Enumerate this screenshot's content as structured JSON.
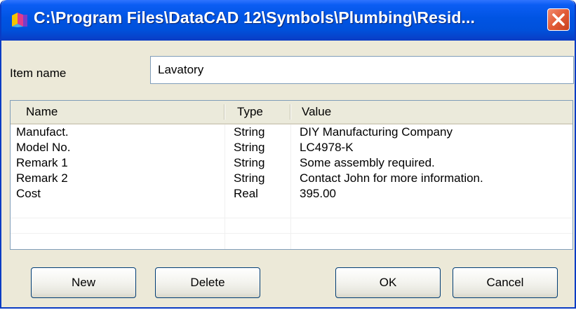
{
  "window": {
    "title": "C:\\Program Files\\DataCAD 12\\Symbols\\Plumbing\\Resid..."
  },
  "item_name": {
    "label": "Item name",
    "value": "Lavatory"
  },
  "table": {
    "columns": [
      "Name",
      "Type",
      "Value"
    ],
    "rows": [
      {
        "name": "Manufact.",
        "type": "String",
        "value": "DIY Manufacturing Company"
      },
      {
        "name": "Model No.",
        "type": "String",
        "value": "LC4978-K"
      },
      {
        "name": "Remark 1",
        "type": "String",
        "value": "Some assembly required."
      },
      {
        "name": "Remark 2",
        "type": "String",
        "value": "Contact John for more information."
      },
      {
        "name": "Cost",
        "type": "Real",
        "value": "395.00"
      }
    ]
  },
  "buttons": {
    "new": "New",
    "delete": "Delete",
    "ok": "OK",
    "cancel": "Cancel"
  },
  "icons": {
    "app": "datacad-app-icon",
    "close": "close-icon"
  },
  "colors": {
    "titlebar": "#0054e3",
    "close": "#e25b36",
    "face": "#ece9d8"
  }
}
